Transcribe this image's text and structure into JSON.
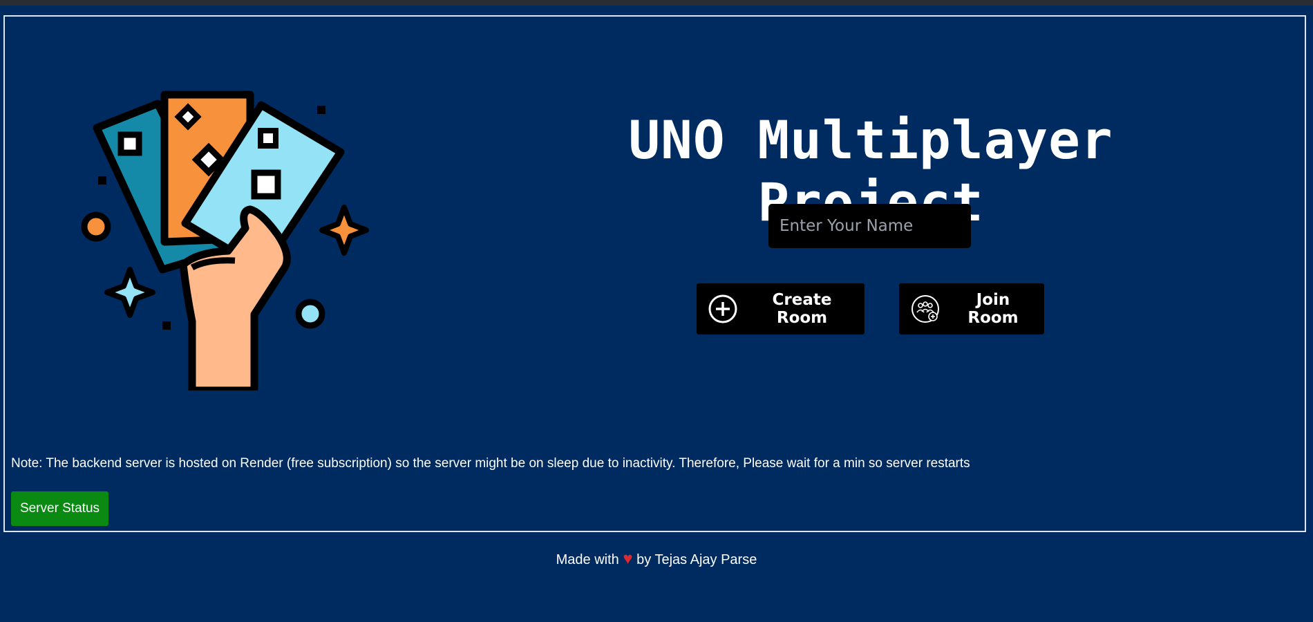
{
  "app": {
    "title": "UNO Multiplayer Project"
  },
  "form": {
    "name_placeholder": "Enter Your Name",
    "name_value": ""
  },
  "actions": {
    "create_room_label": "Create Room",
    "join_room_label": "Join Room"
  },
  "note": {
    "text": "Note: The backend server is hosted on Render (free subscription) so the server might be on sleep due to inactivity. Therefore, Please wait for a min so server restarts"
  },
  "server_status": {
    "label": "Server Status",
    "color": "#0a8a13"
  },
  "footer": {
    "prefix": "Made with",
    "heart": "♥",
    "suffix": "by Tejas Ajay Parse"
  },
  "icons": {
    "illustration": "hand-holding-cards-illustration",
    "create": "plus-circle-icon",
    "join": "group-add-icon"
  },
  "colors": {
    "background": "#002b60",
    "button": "#000000",
    "heart": "#e0282e",
    "card_teal": "#1589a8",
    "card_orange": "#f8913c",
    "card_light_blue": "#93e2f5",
    "skin": "#ffb98a"
  }
}
